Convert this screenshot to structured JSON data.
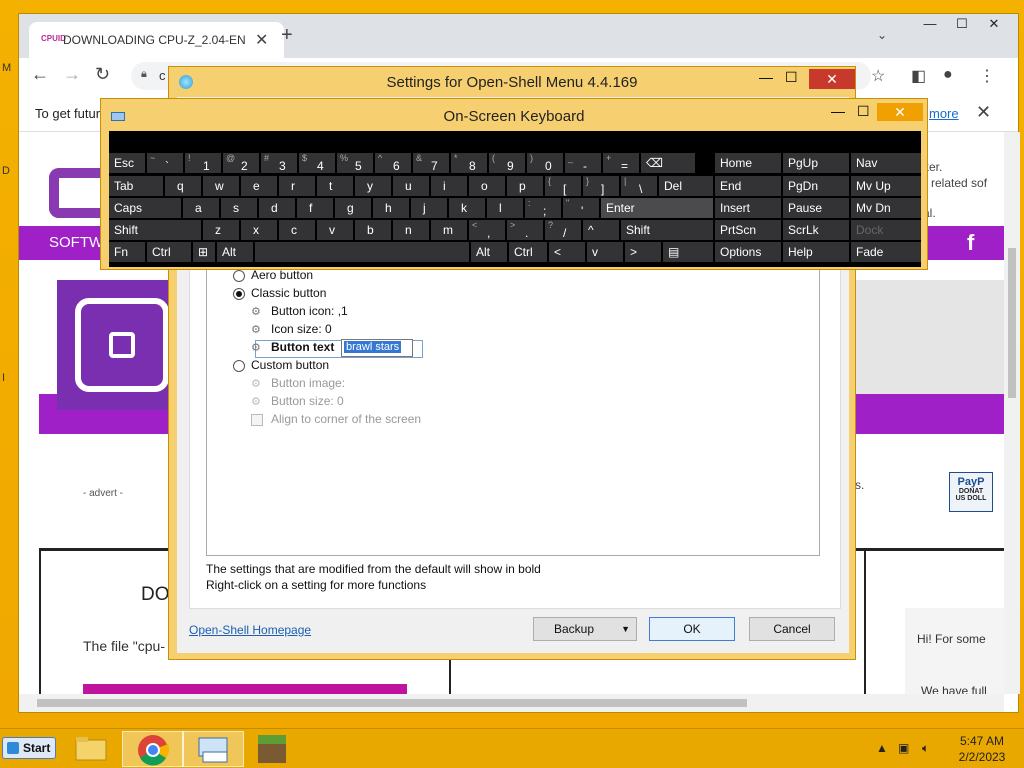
{
  "desktop": {
    "left_letters": [
      "M",
      "D",
      "I"
    ]
  },
  "chrome": {
    "tab_title": "DOWNLOADING CPU-Z_2.04-EN",
    "favicon_text": "CPUID",
    "new_tab": "+",
    "omnibox_text": "c",
    "window_buttons": [
      "—",
      "☐",
      "✕"
    ],
    "infobar_text": "To get futur",
    "infobar_link": "more",
    "page": {
      "nav_text": "SOFTW",
      "fb": "f",
      "right_texts": [
        "ker.",
        "related sof",
        "al.",
        "s."
      ],
      "advert": "- advert -",
      "paypal_lines": [
        "PayP",
        "DONAT",
        "US DOLL"
      ],
      "download_title": "DO",
      "file_text": "The file \"cpu-",
      "chat_line1": "Hi! For some",
      "chat_line2": "We have full"
    }
  },
  "settings": {
    "title": "Settings for Open-Shell Menu 4.4.169",
    "options": {
      "aero": "Aero button",
      "classic": "Classic button",
      "button_icon": "Button icon: ,1",
      "icon_size": "Icon size: 0",
      "button_text": "Button text",
      "button_text_value": "brawl stars",
      "custom": "Custom button",
      "button_image": "Button image:",
      "button_size": "Button size: 0",
      "align_corner": "Align to corner of the screen"
    },
    "note1": "The settings that are modified from the default will show in bold",
    "note2": "Right-click on a setting for more functions",
    "homepage_link": "Open-Shell Homepage",
    "backup_label": "Backup",
    "ok_label": "OK",
    "cancel_label": "Cancel"
  },
  "osk": {
    "title": "On-Screen Keyboard",
    "row1": {
      "esc": "Esc",
      "keys": [
        {
          "s": "~",
          "p": "`"
        },
        {
          "s": "!",
          "p": "1"
        },
        {
          "s": "@",
          "p": "2"
        },
        {
          "s": "#",
          "p": "3"
        },
        {
          "s": "$",
          "p": "4"
        },
        {
          "s": "%",
          "p": "5"
        },
        {
          "s": "^",
          "p": "6"
        },
        {
          "s": "&",
          "p": "7"
        },
        {
          "s": "*",
          "p": "8"
        },
        {
          "s": "(",
          "p": "9"
        },
        {
          "s": ")",
          "p": "0"
        },
        {
          "s": "_",
          "p": "-"
        },
        {
          "s": "+",
          "p": "="
        }
      ]
    },
    "row2": {
      "tab": "Tab",
      "letters": [
        "q",
        "w",
        "e",
        "r",
        "t",
        "y",
        "u",
        "i",
        "o",
        "p"
      ],
      "brackets": [
        {
          "s": "{",
          "p": "["
        },
        {
          "s": "}",
          "p": "]"
        },
        {
          "s": "|",
          "p": "\\"
        }
      ],
      "del": "Del"
    },
    "row3": {
      "caps": "Caps",
      "letters": [
        "a",
        "s",
        "d",
        "f",
        "g",
        "h",
        "j",
        "k",
        "l"
      ],
      "punct": [
        {
          "s": ":",
          "p": ";"
        },
        {
          "s": "\"",
          "p": "'"
        }
      ],
      "enter": "Enter"
    },
    "row4": {
      "shift": "Shift",
      "letters": [
        "z",
        "x",
        "c",
        "v",
        "b",
        "n",
        "m"
      ],
      "punct": [
        {
          "s": "<",
          "p": ","
        },
        {
          "s": ">",
          "p": "."
        },
        {
          "s": "?",
          "p": "/"
        }
      ],
      "up": "^",
      "shift_r": "Shift"
    },
    "row5": {
      "fn": "Fn",
      "ctrl": "Ctrl",
      "alt": "Alt",
      "alt_r": "Alt",
      "ctrl_r": "Ctrl",
      "left": "<",
      "down": "v",
      "right": ">"
    },
    "nav": [
      [
        "Home",
        "PgUp",
        "Nav"
      ],
      [
        "End",
        "PgDn",
        "Mv Up"
      ],
      [
        "Insert",
        "Pause",
        "Mv Dn"
      ],
      [
        "PrtScn",
        "ScrLk",
        "Dock"
      ],
      [
        "Options",
        "Help",
        "Fade"
      ]
    ]
  },
  "taskbar": {
    "start": "Start",
    "time": "5:47 AM",
    "date": "2/2/2023"
  }
}
